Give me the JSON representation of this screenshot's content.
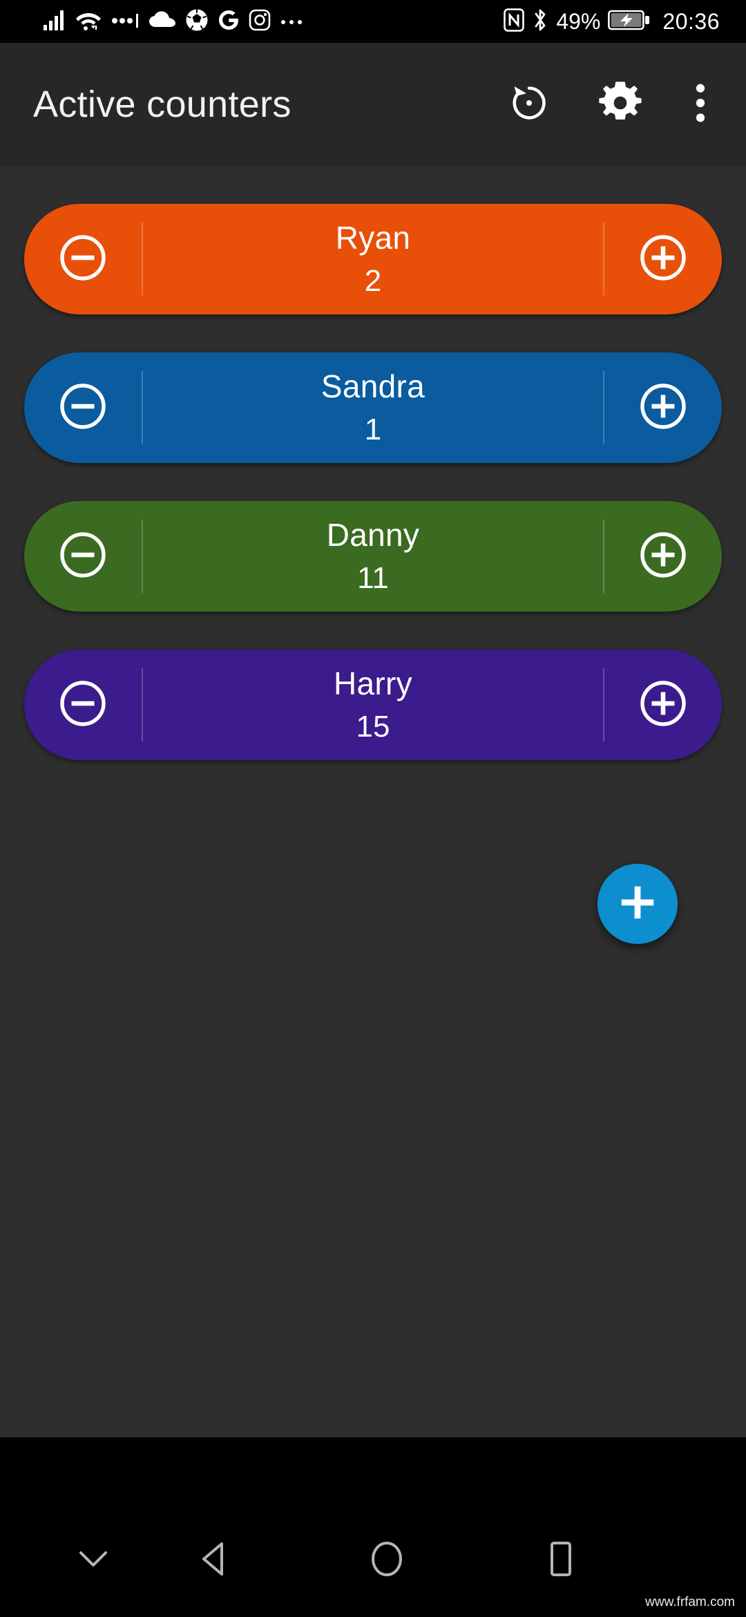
{
  "status_bar": {
    "left_icons": [
      {
        "name": "signal-bars-icon",
        "label": "cellular signal"
      },
      {
        "name": "wifi-icon",
        "label": "wifi"
      },
      {
        "name": "cellular-data-icon",
        "label": "mobile data"
      },
      {
        "name": "cloud-icon",
        "label": "cloud sync"
      },
      {
        "name": "soccer-ball-icon",
        "label": "football app"
      },
      {
        "name": "google-g-icon",
        "label": "Google"
      },
      {
        "name": "instagram-icon",
        "label": "Instagram"
      },
      {
        "name": "more-notifications-icon",
        "label": "more notifications"
      }
    ],
    "nfc_icon": "nfc-icon",
    "bluetooth_icon": "bluetooth-icon",
    "battery_percent": "49%",
    "battery_state": "charging",
    "clock": "20:36"
  },
  "app_bar": {
    "title": "Active counters",
    "actions": [
      {
        "name": "restore-icon",
        "label": "Reset counters"
      },
      {
        "name": "gear-icon",
        "label": "Settings"
      },
      {
        "name": "overflow-menu-icon",
        "label": "More options"
      }
    ]
  },
  "counters": [
    {
      "name": "Ryan",
      "value": "2",
      "color": "#e8500a",
      "decrement_label": "Decrease Ryan",
      "increment_label": "Increase Ryan"
    },
    {
      "name": "Sandra",
      "value": "1",
      "color": "#0a5c9e",
      "decrement_label": "Decrease Sandra",
      "increment_label": "Increase Sandra"
    },
    {
      "name": "Danny",
      "value": "11",
      "color": "#3a6b20",
      "decrement_label": "Decrease Danny",
      "increment_label": "Increase Danny"
    },
    {
      "name": "Harry",
      "value": "15",
      "color": "#3c1b8c",
      "decrement_label": "Decrease Harry",
      "increment_label": "Increase Harry"
    }
  ],
  "fab": {
    "icon": "plus-icon",
    "label": "Add counter",
    "color": "#0d8ecf"
  },
  "nav_bar": {
    "buttons": [
      {
        "name": "hide-navbar-icon",
        "label": "Hide navigation bar"
      },
      {
        "name": "back-icon",
        "label": "Back"
      },
      {
        "name": "home-icon",
        "label": "Home"
      },
      {
        "name": "recents-icon",
        "label": "Recent apps"
      }
    ]
  },
  "watermark": "www.frfam.com",
  "theme": {
    "background": "#2e2e2e",
    "app_bar_background": "#272727",
    "status_bar_background": "#000000",
    "text_primary": "#f2f2f2"
  }
}
